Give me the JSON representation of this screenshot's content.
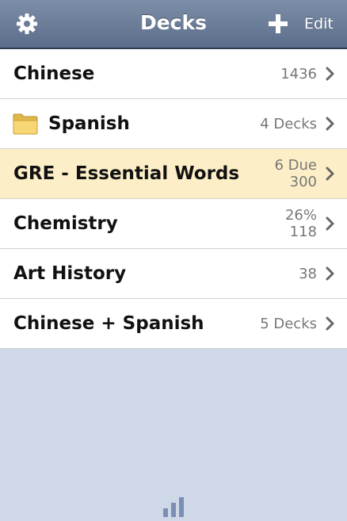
{
  "navbar": {
    "title": "Decks",
    "edit_label": "Edit",
    "left_icon": "gear-icon",
    "add_icon": "plus-icon"
  },
  "decks": [
    {
      "name": "Chinese",
      "meta": [
        "1436"
      ],
      "folder": false,
      "highlight": false
    },
    {
      "name": "Spanish",
      "meta": [
        "4 Decks"
      ],
      "folder": true,
      "highlight": false
    },
    {
      "name": "GRE - Essential Words",
      "meta": [
        "6 Due",
        "300"
      ],
      "folder": false,
      "highlight": true
    },
    {
      "name": "Chemistry",
      "meta": [
        "26%",
        "118"
      ],
      "folder": false,
      "highlight": false
    },
    {
      "name": "Art History",
      "meta": [
        "38"
      ],
      "folder": false,
      "highlight": false
    },
    {
      "name": "Chinese + Spanish",
      "meta": [
        "5 Decks"
      ],
      "folder": false,
      "highlight": false
    }
  ],
  "footer": {
    "icon": "bar-chart-icon"
  },
  "colors": {
    "navbar": "#65769a",
    "background": "#cfd8e6",
    "highlight_row": "#fcefc7",
    "stats_icon": "#7b8fb5"
  }
}
